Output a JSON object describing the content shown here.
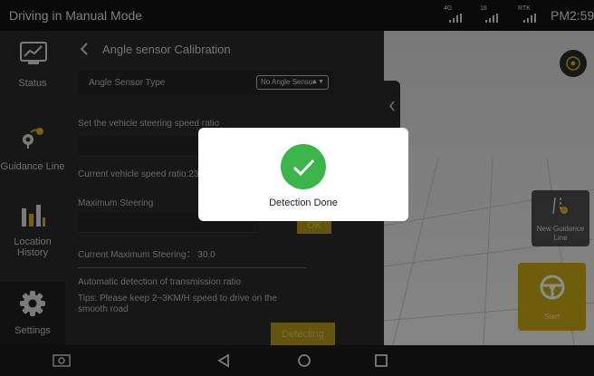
{
  "status_bar": {
    "mode_title": "Driving in Manual Mode",
    "signal_4g_label": "4G",
    "signal_sat_label": "18",
    "signal_rtk_label": "RTK",
    "clock": "PM2:59"
  },
  "sidebar": {
    "items": [
      {
        "label": "Status",
        "icon": "chart-icon"
      },
      {
        "label": "Guidance Line",
        "icon": "route-pin-icon"
      },
      {
        "label": "Location History",
        "icon": "bar-chart-icon"
      },
      {
        "label": "Settings",
        "icon": "gear-icon"
      }
    ],
    "active": "Settings"
  },
  "panel": {
    "title": "Angle sensor Calibration",
    "sensor_type_label": "Angle Sensor Type",
    "sensor_type_value": "No Angle Sensor",
    "steering_ratio_label": "Set the vehicle steering speed ratio",
    "current_speed_ratio": "Current vehicle speed ratio:23.",
    "max_steering_label": "Maximum Steering",
    "ok_button": "OK",
    "current_max_steering": "Current Maximum Steering： 30.0",
    "auto_detect_label": "Automatic detection of transmission ratio",
    "tips": "Tips: Please keep 2~3KM/H speed to drive on the smooth road",
    "detecting_button": "Detecting"
  },
  "map_view": {
    "new_guidance_line": "New Guidance Line",
    "start_button": "Start"
  },
  "dialog": {
    "message": "Detection Done"
  },
  "colors": {
    "accent_gold": "#b59a1b",
    "success_green": "#3bb54a",
    "panel_bg": "#2a2a2a"
  }
}
